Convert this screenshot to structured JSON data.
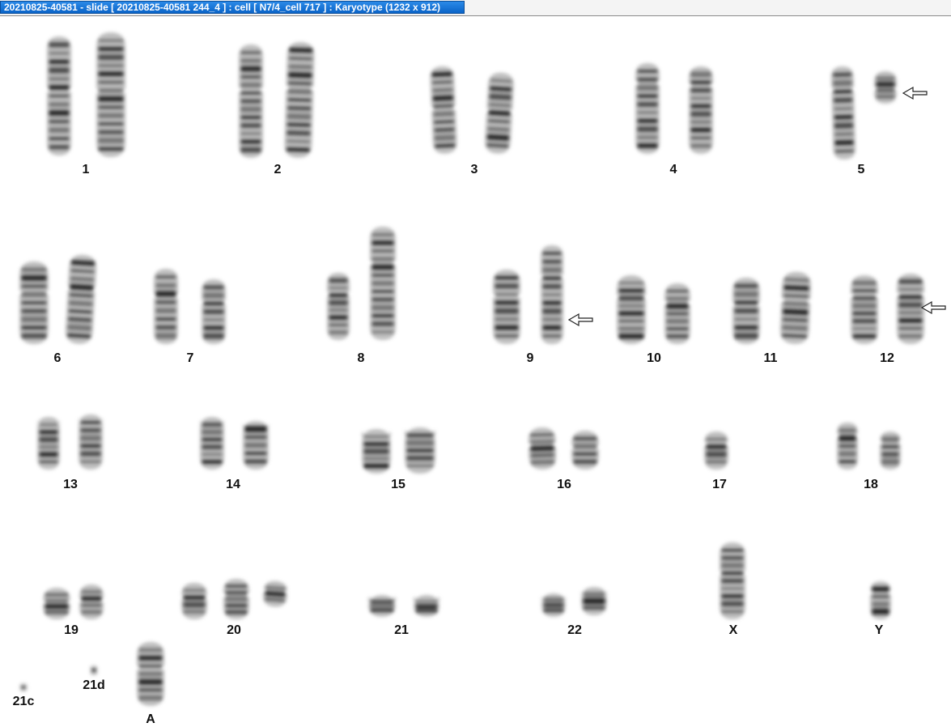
{
  "window": {
    "title": "20210825-40581 - slide [ 20210825-40581 244_4 ] : cell [ N7/4_cell 717 ] : Karyotype  (1232 x 912)"
  },
  "karyotype": {
    "labels": {
      "chr1": "1",
      "chr2": "2",
      "chr3": "3",
      "chr4": "4",
      "chr5": "5",
      "chr6": "6",
      "chr7": "7",
      "chr8": "8",
      "chr9": "9",
      "chr10": "10",
      "chr11": "11",
      "chr12": "12",
      "chr13": "13",
      "chr14": "14",
      "chr15": "15",
      "chr16": "16",
      "chr17": "17",
      "chr18": "18",
      "chr19": "19",
      "chr20": "20",
      "chr21": "21",
      "chr22": "22",
      "chrX": "X",
      "chrY": "Y",
      "chr21c": "21c",
      "chr21d": "21d",
      "chrA": "A"
    },
    "colors": {
      "chromatin": "#1e1e1e",
      "arrow": "#222222",
      "background": "#ffffff"
    },
    "icons": {
      "abnormality_marker": "arrow-left-icon"
    }
  }
}
